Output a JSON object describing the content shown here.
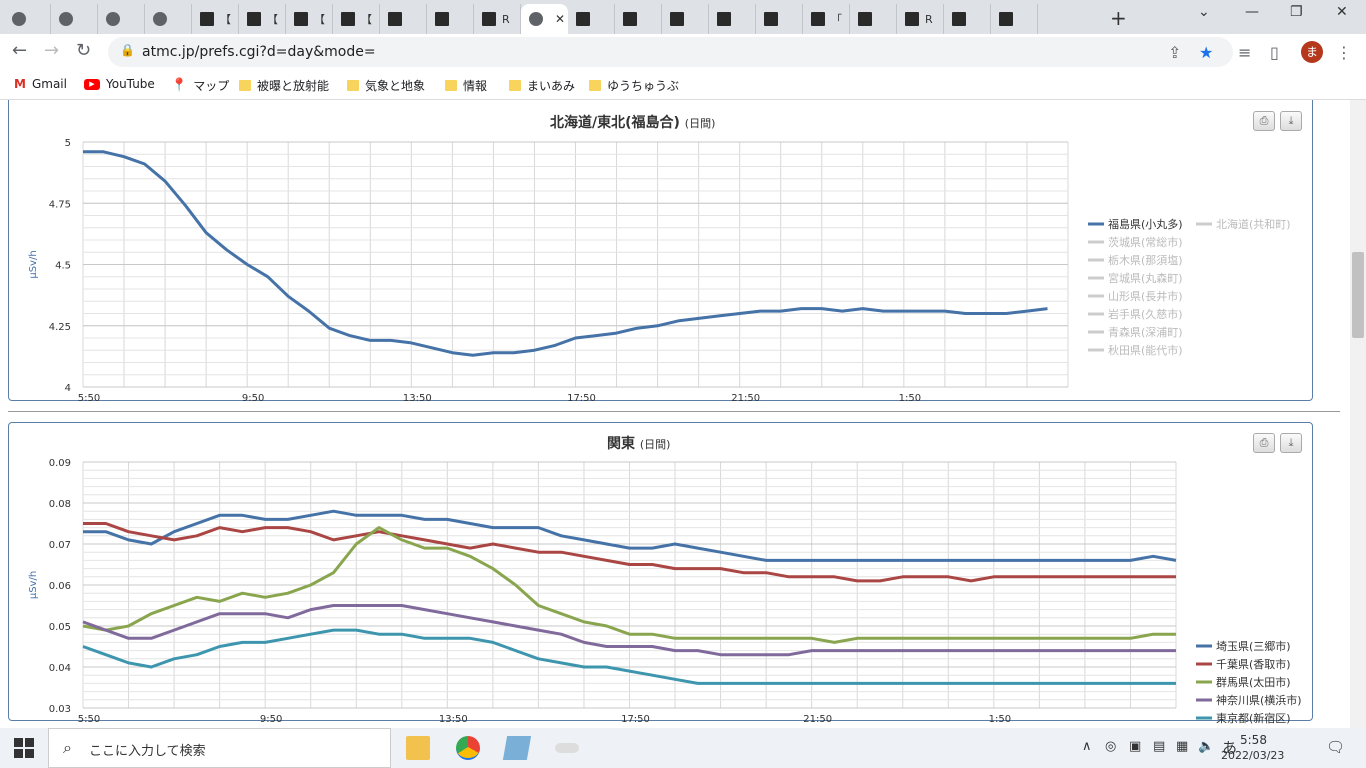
{
  "browser": {
    "tabs": [
      {
        "label": "",
        "favicon": "globe"
      },
      {
        "label": "",
        "favicon": "globe"
      },
      {
        "label": "",
        "favicon": "globe"
      },
      {
        "label": "",
        "favicon": "globe"
      },
      {
        "label": "【",
        "favicon": "image"
      },
      {
        "label": "【",
        "favicon": "image"
      },
      {
        "label": "【",
        "favicon": "image"
      },
      {
        "label": "【",
        "favicon": "image"
      },
      {
        "label": "",
        "favicon": "image"
      },
      {
        "label": "",
        "favicon": "image"
      },
      {
        "label": "R",
        "favicon": "image"
      },
      {
        "label": "",
        "favicon": "globe",
        "active": true
      },
      {
        "label": "",
        "favicon": "image"
      },
      {
        "label": "",
        "favicon": "image"
      },
      {
        "label": "",
        "favicon": "image"
      },
      {
        "label": "",
        "favicon": "image"
      },
      {
        "label": "",
        "favicon": "image"
      },
      {
        "label": "「",
        "favicon": "image"
      },
      {
        "label": "",
        "favicon": "image"
      },
      {
        "label": "R",
        "favicon": "image"
      },
      {
        "label": "",
        "favicon": "image"
      },
      {
        "label": "",
        "favicon": "image"
      }
    ],
    "url": "atmc.jp/prefs.cgi?d=day&mode=",
    "profile_initial": "ま",
    "bookmarks": [
      {
        "label": "Gmail",
        "icon": "gmail-icon"
      },
      {
        "label": "YouTube",
        "icon": "youtube-icon"
      },
      {
        "label": "マップ",
        "icon": "maps-icon"
      },
      {
        "label": "被曝と放射能",
        "icon": "folder-icon"
      },
      {
        "label": "気象と地象",
        "icon": "folder-icon"
      },
      {
        "label": "情報",
        "icon": "folder-icon"
      },
      {
        "label": "まいあみ",
        "icon": "folder-icon"
      },
      {
        "label": "ゆうちゅうぶ",
        "icon": "folder-icon"
      }
    ]
  },
  "panels": {
    "top": {
      "title": "北海道/東北(福島合)",
      "subtitle": "(日間)"
    },
    "bottom": {
      "title": "関東",
      "subtitle": "(日間)"
    }
  },
  "chart_data": [
    {
      "type": "line",
      "title": "北海道/東北(福島合)",
      "subtitle": "(日間)",
      "ylabel": "µSv/h",
      "ylim": [
        4,
        5
      ],
      "yticks": [
        4,
        4.25,
        4.5,
        4.75,
        5
      ],
      "ytick_labels": [
        "4",
        "4.25",
        "4.5",
        "4.75",
        "5"
      ],
      "xtick_labels": [
        "5:50",
        "9:50",
        "13:50",
        "17:50",
        "21:50",
        "1:50"
      ],
      "x_range_hours": [
        0,
        24
      ],
      "grid": true,
      "legend_position": "right",
      "legend": [
        {
          "name": "福島県(小丸多)",
          "active": true,
          "color": "#4572a7"
        },
        {
          "name": "北海道(共和町)",
          "active": false
        },
        {
          "name": "茨城県(常総市)",
          "active": false
        },
        {
          "name": "栃木県(那須塩)",
          "active": false
        },
        {
          "name": "宮城県(丸森町)",
          "active": false
        },
        {
          "name": "山形県(長井市)",
          "active": false
        },
        {
          "name": "岩手県(久慈市)",
          "active": false
        },
        {
          "name": "青森県(深浦町)",
          "active": false
        },
        {
          "name": "秋田県(能代市)",
          "active": false
        }
      ],
      "series": [
        {
          "name": "福島県(小丸多)",
          "color": "#4572a7",
          "x": [
            0,
            0.5,
            1,
            1.5,
            2,
            2.5,
            3,
            3.5,
            4,
            4.5,
            5,
            5.5,
            6,
            6.5,
            7,
            7.5,
            8,
            8.5,
            9,
            9.5,
            10,
            10.5,
            11,
            11.5,
            12,
            12.5,
            13,
            13.5,
            14,
            14.5,
            15,
            15.5,
            16,
            16.5,
            17,
            17.5,
            18,
            18.5,
            19,
            19.5,
            20,
            20.5,
            21,
            21.5,
            22,
            22.5,
            23,
            23.5
          ],
          "values": [
            4.96,
            4.96,
            4.94,
            4.91,
            4.84,
            4.74,
            4.63,
            4.56,
            4.5,
            4.45,
            4.37,
            4.31,
            4.24,
            4.21,
            4.19,
            4.19,
            4.18,
            4.16,
            4.14,
            4.13,
            4.14,
            4.14,
            4.15,
            4.17,
            4.2,
            4.21,
            4.22,
            4.24,
            4.25,
            4.27,
            4.28,
            4.29,
            4.3,
            4.31,
            4.31,
            4.32,
            4.32,
            4.31,
            4.32,
            4.31,
            4.31,
            4.31,
            4.31,
            4.3,
            4.3,
            4.3,
            4.31,
            4.32
          ]
        }
      ]
    },
    {
      "type": "line",
      "title": "関東",
      "subtitle": "(日間)",
      "ylabel": "µSv/h",
      "ylim": [
        0.03,
        0.09
      ],
      "yticks": [
        0.03,
        0.04,
        0.05,
        0.06,
        0.07,
        0.08,
        0.09
      ],
      "ytick_labels": [
        "0.03",
        "0.04",
        "0.05",
        "0.06",
        "0.07",
        "0.08",
        "0.09"
      ],
      "xtick_labels": [
        "5:50",
        "9:50",
        "13:50",
        "17:50",
        "21:50",
        "1:50"
      ],
      "x_range_hours": [
        0,
        24
      ],
      "grid": true,
      "legend_position": "right",
      "x": [
        0,
        0.5,
        1,
        1.5,
        2,
        2.5,
        3,
        3.5,
        4,
        4.5,
        5,
        5.5,
        6,
        6.5,
        7,
        7.5,
        8,
        8.5,
        9,
        9.5,
        10,
        10.5,
        11,
        11.5,
        12,
        12.5,
        13,
        13.5,
        14,
        14.5,
        15,
        15.5,
        16,
        16.5,
        17,
        17.5,
        18,
        18.5,
        19,
        19.5,
        20,
        20.5,
        21,
        21.5,
        22,
        22.5,
        23,
        23.5,
        24
      ],
      "series": [
        {
          "name": "埼玉県(三郷市)",
          "color": "#4572a7",
          "values": [
            0.073,
            0.073,
            0.071,
            0.07,
            0.073,
            0.075,
            0.077,
            0.077,
            0.076,
            0.076,
            0.077,
            0.078,
            0.077,
            0.077,
            0.077,
            0.076,
            0.076,
            0.075,
            0.074,
            0.074,
            0.074,
            0.072,
            0.071,
            0.07,
            0.069,
            0.069,
            0.07,
            0.069,
            0.068,
            0.067,
            0.066,
            0.066,
            0.066,
            0.066,
            0.066,
            0.066,
            0.066,
            0.066,
            0.066,
            0.066,
            0.066,
            0.066,
            0.066,
            0.066,
            0.066,
            0.066,
            0.066,
            0.067,
            0.066
          ]
        },
        {
          "name": "千葉県(香取市)",
          "color": "#aa4643",
          "values": [
            0.075,
            0.075,
            0.073,
            0.072,
            0.071,
            0.072,
            0.074,
            0.073,
            0.074,
            0.074,
            0.073,
            0.071,
            0.072,
            0.073,
            0.072,
            0.071,
            0.07,
            0.069,
            0.07,
            0.069,
            0.068,
            0.068,
            0.067,
            0.066,
            0.065,
            0.065,
            0.064,
            0.064,
            0.064,
            0.063,
            0.063,
            0.062,
            0.062,
            0.062,
            0.061,
            0.061,
            0.062,
            0.062,
            0.062,
            0.061,
            0.062,
            0.062,
            0.062,
            0.062,
            0.062,
            0.062,
            0.062,
            0.062,
            0.062
          ]
        },
        {
          "name": "群馬県(太田市)",
          "color": "#89a54e",
          "values": [
            0.05,
            0.049,
            0.05,
            0.053,
            0.055,
            0.057,
            0.056,
            0.058,
            0.057,
            0.058,
            0.06,
            0.063,
            0.07,
            0.074,
            0.071,
            0.069,
            0.069,
            0.067,
            0.064,
            0.06,
            0.055,
            0.053,
            0.051,
            0.05,
            0.048,
            0.048,
            0.047,
            0.047,
            0.047,
            0.047,
            0.047,
            0.047,
            0.047,
            0.046,
            0.047,
            0.047,
            0.047,
            0.047,
            0.047,
            0.047,
            0.047,
            0.047,
            0.047,
            0.047,
            0.047,
            0.047,
            0.047,
            0.048,
            0.048
          ]
        },
        {
          "name": "神奈川県(横浜市)",
          "color": "#80699b",
          "values": [
            0.051,
            0.049,
            0.047,
            0.047,
            0.049,
            0.051,
            0.053,
            0.053,
            0.053,
            0.052,
            0.054,
            0.055,
            0.055,
            0.055,
            0.055,
            0.054,
            0.053,
            0.052,
            0.051,
            0.05,
            0.049,
            0.048,
            0.046,
            0.045,
            0.045,
            0.045,
            0.044,
            0.044,
            0.043,
            0.043,
            0.043,
            0.043,
            0.044,
            0.044,
            0.044,
            0.044,
            0.044,
            0.044,
            0.044,
            0.044,
            0.044,
            0.044,
            0.044,
            0.044,
            0.044,
            0.044,
            0.044,
            0.044,
            0.044
          ]
        },
        {
          "name": "東京都(新宿区)",
          "color": "#3d96ae",
          "values": [
            0.045,
            0.043,
            0.041,
            0.04,
            0.042,
            0.043,
            0.045,
            0.046,
            0.046,
            0.047,
            0.048,
            0.049,
            0.049,
            0.048,
            0.048,
            0.047,
            0.047,
            0.047,
            0.046,
            0.044,
            0.042,
            0.041,
            0.04,
            0.04,
            0.039,
            0.038,
            0.037,
            0.036,
            0.036,
            0.036,
            0.036,
            0.036,
            0.036,
            0.036,
            0.036,
            0.036,
            0.036,
            0.036,
            0.036,
            0.036,
            0.036,
            0.036,
            0.036,
            0.036,
            0.036,
            0.036,
            0.036,
            0.036,
            0.036
          ]
        }
      ]
    }
  ],
  "taskbar": {
    "search_placeholder": "ここに入力して検索",
    "ime": "あ",
    "time": "5:58",
    "date": "2022/03/23"
  }
}
